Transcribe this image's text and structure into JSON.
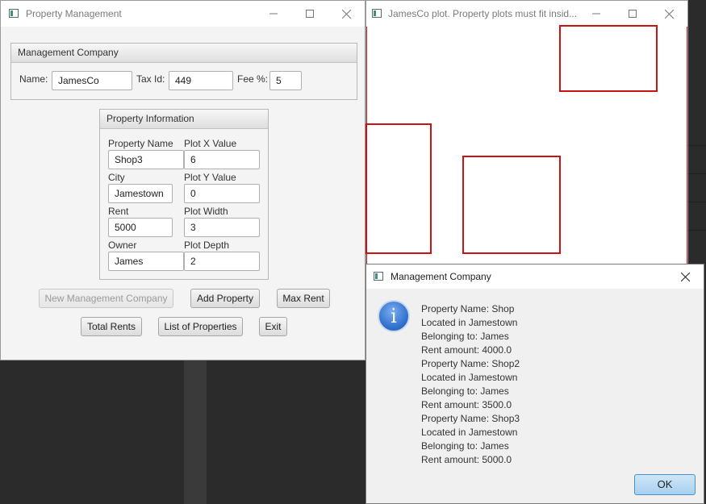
{
  "main_window": {
    "title": "Property Management",
    "management_company": {
      "header": "Management Company",
      "name_label": "Name:",
      "name_value": "JamesCo",
      "taxid_label": "Tax Id:",
      "taxid_value": "449",
      "fee_label": "Fee %:",
      "fee_value": "5"
    },
    "property_info": {
      "header": "Property Information",
      "property_name_label": "Property Name",
      "property_name_value": "Shop3",
      "plot_x_label": "Plot X Value",
      "plot_x_value": "6",
      "city_label": "City",
      "city_value": "Jamestown",
      "plot_y_label": "Plot Y Value",
      "plot_y_value": "0",
      "rent_label": "Rent",
      "rent_value": "5000",
      "plot_width_label": "Plot Width",
      "plot_width_value": "3",
      "owner_label": "Owner",
      "owner_value": "James",
      "plot_depth_label": "Plot Depth",
      "plot_depth_value": "2"
    },
    "buttons": {
      "new_company": "New Management Company",
      "add_property": "Add Property",
      "max_rent": "Max Rent",
      "total_rents": "Total Rents",
      "list_properties": "List of Properties",
      "exit": "Exit"
    }
  },
  "plot_window": {
    "title": "JamesCo plot. Property plots must fit insid...",
    "border_color": "#cc1111"
  },
  "dialog": {
    "title": "Management Company",
    "icon": "info-icon",
    "lines": [
      "Property Name: Shop",
      "Located in Jamestown",
      "Belonging to: James",
      "Rent amount: 4000.0",
      "Property Name: Shop2",
      "Located in Jamestown",
      "Belonging to: James",
      "Rent amount: 3500.0",
      "Property Name: Shop3",
      "Located in Jamestown",
      "Belonging to: James",
      "Rent amount: 5000.0"
    ],
    "ok_label": "OK"
  }
}
